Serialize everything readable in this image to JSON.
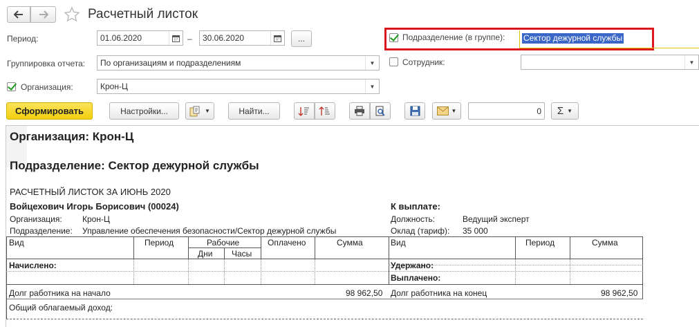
{
  "window": {
    "title": "Расчетный листок"
  },
  "form": {
    "period_label": "Период:",
    "date_from": "01.06.2020",
    "date_sep": "–",
    "date_to": "30.06.2020",
    "period_more": "...",
    "grouping_label": "Группировка отчета:",
    "grouping_value": "По организациям и подразделениям",
    "org_label": "Организация:",
    "org_value": "Крон-Ц",
    "dept_label": "Подразделение (в группе):",
    "dept_value": "Сектор дежурной службы",
    "employee_label": "Сотрудник:",
    "employee_value": ""
  },
  "toolbar": {
    "generate": "Сформировать",
    "settings": "Настройки...",
    "find": "Найти...",
    "sum_value": "0",
    "sigma": "Σ"
  },
  "report": {
    "org_heading": "Организация: Крон-Ц",
    "dept_heading": "Подразделение: Сектор дежурной службы",
    "sheet_title": "РАСЧЕТНЫЙ ЛИСТОК ЗА ИЮНЬ 2020",
    "employee_name": "Войцехович Игорь Борисович (00024)",
    "org_row_label": "Организация:",
    "org_row_value": "Крон-Ц",
    "dept_row_label": "Подразделение:",
    "dept_row_value": "Управление обеспечения безопасности/Сектор дежурной службы",
    "to_pay_label": "К выплате:",
    "position_label": "Должность:",
    "position_value": "Ведущий эксперт",
    "salary_label": "Оклад (тариф):",
    "salary_value": "35 000",
    "left_headers": {
      "type": "Вид",
      "period": "Период",
      "working": "Рабочие",
      "days": "Дни",
      "hours": "Часы",
      "paid": "Оплачено",
      "sum": "Сумма"
    },
    "right_headers": {
      "type": "Вид",
      "period": "Период",
      "sum": "Сумма"
    },
    "accrued_label": "Начислено:",
    "withheld_label": "Удержано:",
    "paid_out_label": "Выплачено:",
    "debt_start_label": "Долг работника на начало",
    "debt_start_value": "98 962,50",
    "debt_end_label": "Долг работника на конец",
    "debt_end_value": "98 962,50",
    "taxable_income_label": "Общий облагаемый доход:"
  },
  "colors": {
    "highlight_border": "#d9171c",
    "selection_bg": "#3a66c7",
    "generate_bg": "#f5d315",
    "check_green": "#1d9a1d"
  }
}
